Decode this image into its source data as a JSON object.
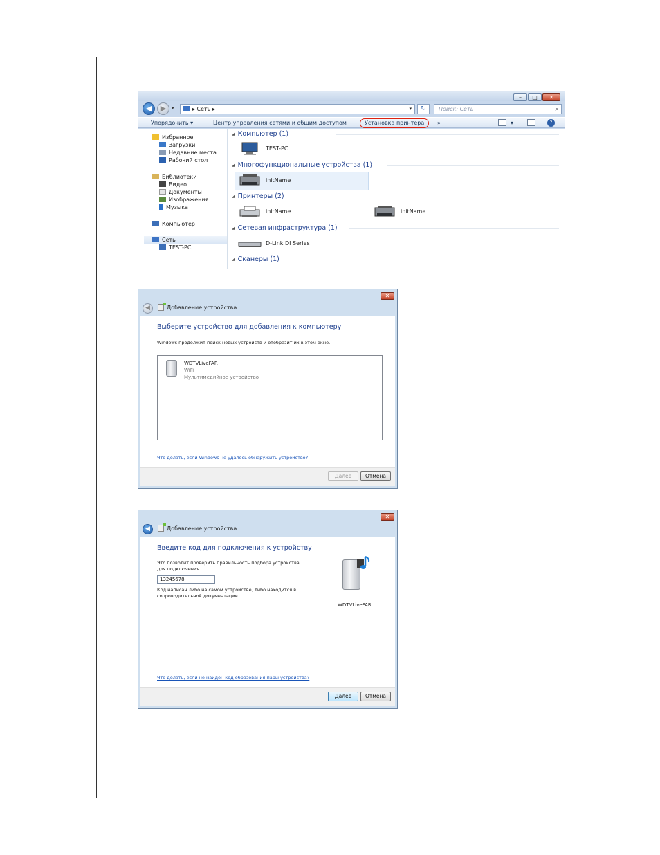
{
  "explorer": {
    "address_path": "▸ Сеть ▸",
    "search_placeholder": "Поиск: Сеть",
    "toolbar": {
      "organize": "Упорядочить ▾",
      "network_center": "Центр управления сетями и общим доступом",
      "add_printer": "Установка принтера",
      "more": "»"
    },
    "nav_items": [
      {
        "label": "Избранное"
      },
      {
        "label": "Загрузки"
      },
      {
        "label": "Недавние места"
      },
      {
        "label": "Рабочий стол"
      },
      {
        "label": "Библиотеки"
      },
      {
        "label": "Видео"
      },
      {
        "label": "Документы"
      },
      {
        "label": "Изображения"
      },
      {
        "label": "Музыка"
      },
      {
        "label": "Компьютер"
      },
      {
        "label": "Сеть"
      },
      {
        "label": "TEST-PC"
      }
    ],
    "groups": [
      {
        "label": "Компьютер (1)"
      },
      {
        "label": "Многофункциональные устройства (1)"
      },
      {
        "label": "Принтеры (2)"
      },
      {
        "label": "Сетевая инфраструктура (1)"
      },
      {
        "label": "Сканеры (1)"
      }
    ],
    "devices": [
      {
        "label": "TEST-PC"
      },
      {
        "label": "initName"
      },
      {
        "label": "initName"
      },
      {
        "label": "initName"
      },
      {
        "label": "D-Link DI Series"
      }
    ]
  },
  "dialog1": {
    "title": "Добавление устройства",
    "heading": "Выберите устройство для добавления к компьютеру",
    "description": "Windows продолжит поиск новых устройств и отобразит их в этом окне.",
    "device": {
      "name": "WDTVLiveFAR",
      "type": "WiFi",
      "category": "Мультимедийное устройство"
    },
    "help_link": "Что делать, если Windows не удалось обнаружить устройство?",
    "next_label": "Далее",
    "cancel_label": "Отмена"
  },
  "dialog2": {
    "title": "Добавление устройства",
    "heading": "Введите код для подключения к устройству",
    "description": "Это позволит проверить правильность подбора устройства для подключения.",
    "code_value": "13245678",
    "hint": "Код написан либо на самом устройстве, либо находится в сопроводительной документации.",
    "device_name": "WDTVLiveFAR",
    "help_link": "Что делать, если не найден код образования пары устройства?",
    "next_label": "Далее",
    "cancel_label": "Отмена"
  }
}
